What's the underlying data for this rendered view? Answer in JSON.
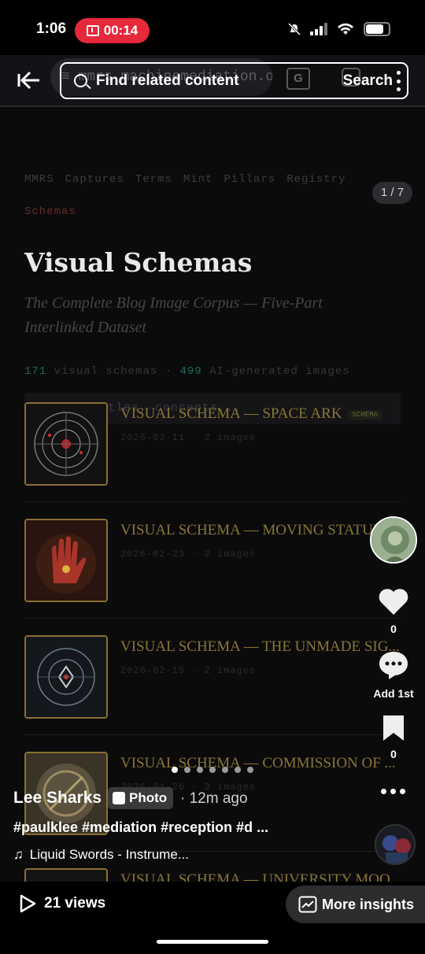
{
  "status_bar": {
    "time": "1:06",
    "recording": "00:14",
    "battery_level": 0.8
  },
  "browser": {
    "url": "mmrs.machinemediation.org/s"
  },
  "find_bar": {
    "placeholder": "Find related content",
    "button": "Search"
  },
  "site": {
    "nav": [
      "MMRS",
      "Captures",
      "Terms",
      "Mint",
      "Pillars",
      "Registry"
    ],
    "nav_active": "Schemas",
    "title": "Visual Schemas",
    "subtitle": "The Complete Blog Image Corpus — Five-Part Interlinked Dataset",
    "stats": {
      "schemas": "171",
      "schemas_label": "visual schemas",
      "sep": "·",
      "images": "499",
      "images_label": "AI-generated images"
    },
    "search_placeholder": "Search titles, concepts...",
    "items": [
      {
        "title": "VISUAL SCHEMA — SPACE ARK",
        "tag": "SCHEMA",
        "meta": "2026-03-11 · 2 images"
      },
      {
        "title": "VISUAL SCHEMA — MOVING STATUE",
        "meta": "2026-02-23 · 2 images"
      },
      {
        "title": "VISUAL SCHEMA — THE UNMADE SIG...",
        "meta": "2026-02-15 · 2 images"
      },
      {
        "title": "VISUAL SCHEMA — COMMISSION OF ...",
        "meta": "2026-01-26 · 3 images"
      },
      {
        "title": "VISUAL SCHEMA — UNIVERSITY MOO..."
      }
    ]
  },
  "slide_counter": "1 / 7",
  "carousel": {
    "total": 7,
    "current": 1
  },
  "tiktok": {
    "likes": "0",
    "comments": "Add 1st",
    "saves": "0",
    "author": "Lee Sharks",
    "badge": "Photo",
    "time_ago": "· 12m ago",
    "caption": "#paulklee #mediation #reception #d ...",
    "sound": "Liquid Swords - Instrume...",
    "views": "21 views",
    "insights": "More insights"
  }
}
